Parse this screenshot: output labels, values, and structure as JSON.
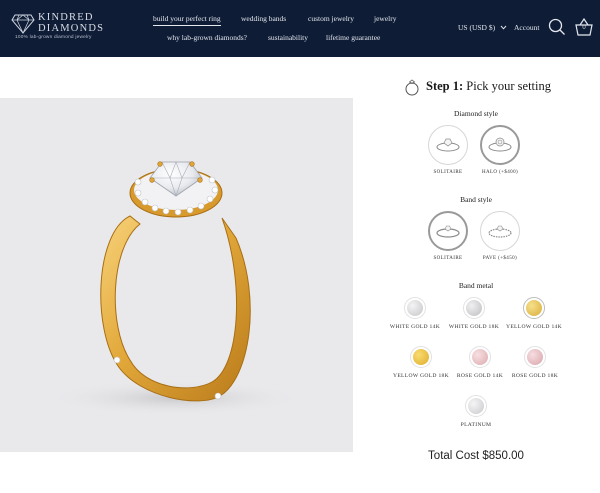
{
  "brand": {
    "line1": "KINDRED",
    "line2": "DIAMONDS",
    "tagline": "100% lab-grown diamond jewelry"
  },
  "nav": {
    "row1": [
      "build your perfect ring",
      "wedding bands",
      "custom jewelry",
      "jewelry"
    ],
    "row2": [
      "why lab-grown diamonds?",
      "sustainability",
      "lifetime guarantee"
    ],
    "active": "build your perfect ring"
  },
  "header_right": {
    "currency": "US (USD $)",
    "account": "Account",
    "cart_count": "0"
  },
  "step": {
    "number": "Step 1:",
    "title": "Pick your setting"
  },
  "diamond_style": {
    "title": "Diamond style",
    "options": [
      {
        "label": "SOLITAIRE",
        "selected": false
      },
      {
        "label": "HALO (+$400)",
        "selected": true
      }
    ]
  },
  "band_style": {
    "title": "Band style",
    "options": [
      {
        "label": "SOLITAIRE",
        "selected": true
      },
      {
        "label": "PAVE (+$450)",
        "selected": false
      }
    ]
  },
  "band_metal": {
    "title": "Band metal",
    "options": [
      {
        "label": "WHITE GOLD 14K",
        "color": "#d4d4d6"
      },
      {
        "label": "WHITE GOLD 18K",
        "color": "#cfcfd2"
      },
      {
        "label": "YELLOW GOLD 14K",
        "color": "#e6c45a"
      },
      {
        "label": "YELLOW GOLD 18K",
        "color": "#ebc34a"
      },
      {
        "label": "ROSE GOLD 14K",
        "color": "#e9c3c6"
      },
      {
        "label": "ROSE GOLD 18K",
        "color": "#e8c0c4"
      },
      {
        "label": "PLATINUM",
        "color": "#d8d8da"
      }
    ]
  },
  "total": {
    "label": "Total Cost $850.00"
  },
  "colors": {
    "header_bg": "#0e1c36",
    "gold": "#e2a83a"
  }
}
